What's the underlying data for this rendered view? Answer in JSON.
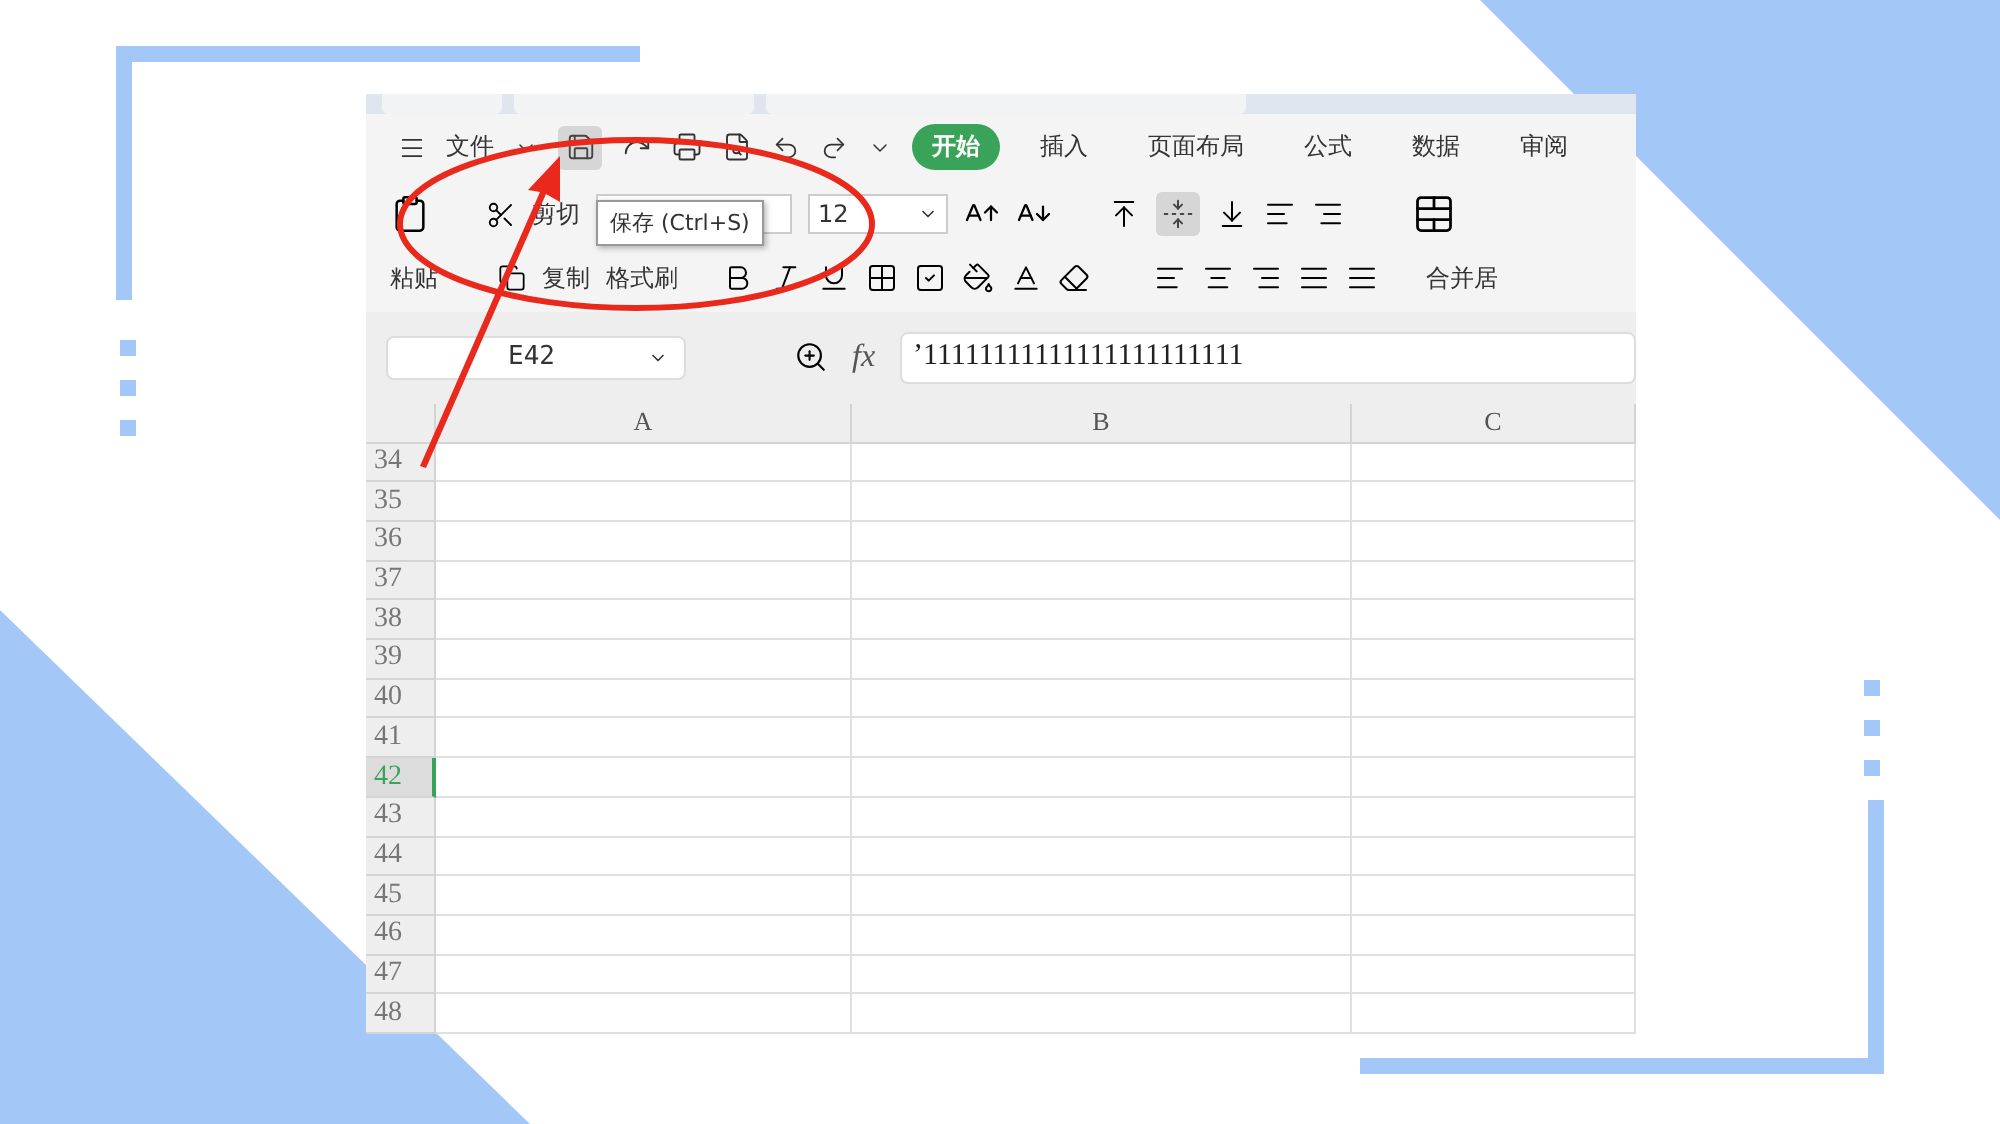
{
  "menu": {
    "label": "文件"
  },
  "tabs": [
    {
      "label": "开始",
      "selected": true
    },
    {
      "label": "插入",
      "selected": false
    },
    {
      "label": "页面布局",
      "selected": false
    },
    {
      "label": "公式",
      "selected": false
    },
    {
      "label": "数据",
      "selected": false
    },
    {
      "label": "审阅",
      "selected": false
    }
  ],
  "ribbon": {
    "paste": "粘贴",
    "cut": "剪切",
    "copy": "复制",
    "format_painter": "格式刷",
    "font_size": "12",
    "merge": "合并居"
  },
  "tooltip": "保存 (Ctrl+S)",
  "formula_bar": {
    "cell": "E42",
    "fx": "fx",
    "formula": "’11111111111111111111111"
  },
  "columns": [
    "A",
    "B",
    "C"
  ],
  "rows": [
    {
      "number": "34",
      "selected": false
    },
    {
      "number": "35",
      "selected": false
    },
    {
      "number": "36",
      "selected": false
    },
    {
      "number": "37",
      "selected": false
    },
    {
      "number": "38",
      "selected": false
    },
    {
      "number": "39",
      "selected": false
    },
    {
      "number": "40",
      "selected": false
    },
    {
      "number": "41",
      "selected": false
    },
    {
      "number": "42",
      "selected": true
    },
    {
      "number": "43",
      "selected": false
    },
    {
      "number": "44",
      "selected": false
    },
    {
      "number": "45",
      "selected": false
    },
    {
      "number": "46",
      "selected": false
    },
    {
      "number": "47",
      "selected": false
    },
    {
      "number": "48",
      "selected": false
    }
  ]
}
